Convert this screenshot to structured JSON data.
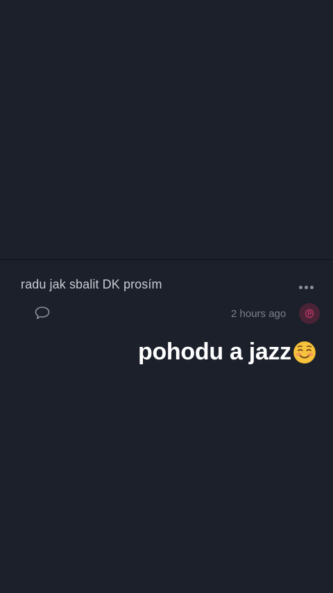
{
  "post": {
    "text": "radu jak sbalit DK prosím",
    "timestamp": "2 hours ago"
  },
  "icons": {
    "more": "more-dots-icon",
    "comment": "speech-bubble-icon",
    "avatar": "anonymous-avatar-icon",
    "emoji": "smiling-blush-face-emoji"
  },
  "overlay": {
    "text": "pohodu a jazz"
  },
  "colors": {
    "background": "#1b202b",
    "avatar_bg": "#4a2337",
    "avatar_accent": "#c23a6a"
  }
}
